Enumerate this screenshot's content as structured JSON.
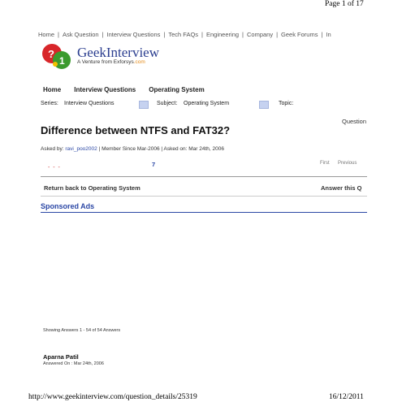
{
  "page_header": {
    "page_of": "Page 1 of 17"
  },
  "top_nav": {
    "items": [
      "Home",
      "Ask Question",
      "Interview Questions",
      "Tech FAQs",
      "Engineering",
      "Company",
      "Geek Forums",
      "In"
    ],
    "separator": "|"
  },
  "logo": {
    "title": "GeekInterview",
    "tagline": "A Venture from Exforsys.com",
    "tagline_prefix": "A Venture from Exforsys",
    "tagline_domain": ".com",
    "ball_colors": {
      "red": "#d8262a",
      "green": "#3c9a2e",
      "dot": "#f3c000"
    },
    "ball_numbers": [
      "?",
      "1"
    ]
  },
  "section_nav": {
    "items": [
      "Home",
      "Interview Questions",
      "Operating System"
    ]
  },
  "filters": {
    "series_label": "Series:",
    "series_value": "Interview Questions",
    "subject_label": "Subject:",
    "subject_value": "Operating System",
    "topic_label": "Topic:"
  },
  "question": {
    "label": "Question",
    "title": "Difference between NTFS and FAT32?",
    "asked_by_label": "Asked by:",
    "asked_by_user": "ravi_poo2002",
    "member_since": "| Member Since Mar-2006 | Asked on: Mar 24th, 2006",
    "answer_count_glyph": "7",
    "dashes": "- - -"
  },
  "pager": {
    "first": "First",
    "previous": "Previous"
  },
  "actions": {
    "return_label": "Return back to Operating System",
    "answer_label": "Answer this Q"
  },
  "sponsored": {
    "label": "Sponsored Ads"
  },
  "answers": {
    "showing": "Showing Answers 1 - 54 of 54 Answers",
    "first_answer_name": "Aparna Patil",
    "first_answer_date": "Answered On : Mar 24th, 2006"
  },
  "footer": {
    "url": "http://www.geekinterview.com/question_details/25319",
    "date": "16/12/2011"
  },
  "colors": {
    "link": "#2b47a5",
    "logo_text": "#2a3d8f",
    "logo_domain": "#e38a17"
  }
}
